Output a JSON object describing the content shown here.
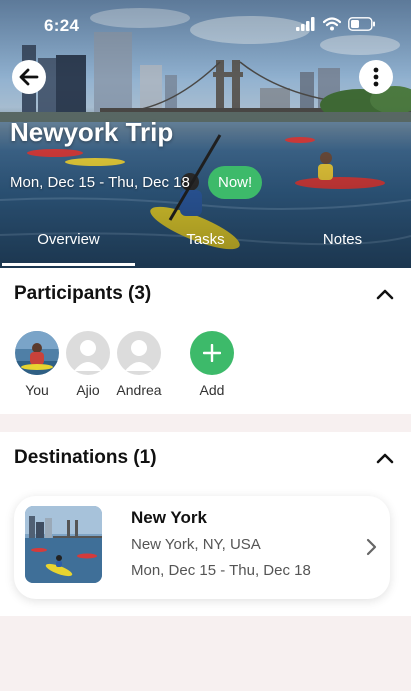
{
  "status_bar": {
    "time": "6:24"
  },
  "trip": {
    "title": "Newyork Trip",
    "dates": "Mon, Dec 15 - Thu, Dec 18",
    "badge": "Now!"
  },
  "tabs": [
    {
      "label": "Overview",
      "active": true
    },
    {
      "label": "Tasks",
      "active": false
    },
    {
      "label": "Notes",
      "active": false
    }
  ],
  "participants": {
    "title": "Participants (3)",
    "people": [
      {
        "name": "You",
        "avatar": "photo"
      },
      {
        "name": "Ajio",
        "avatar": "default-person-icon"
      },
      {
        "name": "Andrea",
        "avatar": "default-person-icon"
      }
    ],
    "add_label": "Add"
  },
  "destinations": {
    "title": "Destinations (1)",
    "items": [
      {
        "name": "New York",
        "location": "New York, NY, USA",
        "dates": "Mon, Dec 15 - Thu, Dec 18"
      }
    ]
  },
  "colors": {
    "accent_green": "#3dba6a",
    "background": "#f7f0f0",
    "text_dark": "#111111",
    "text_muted": "#555555"
  }
}
